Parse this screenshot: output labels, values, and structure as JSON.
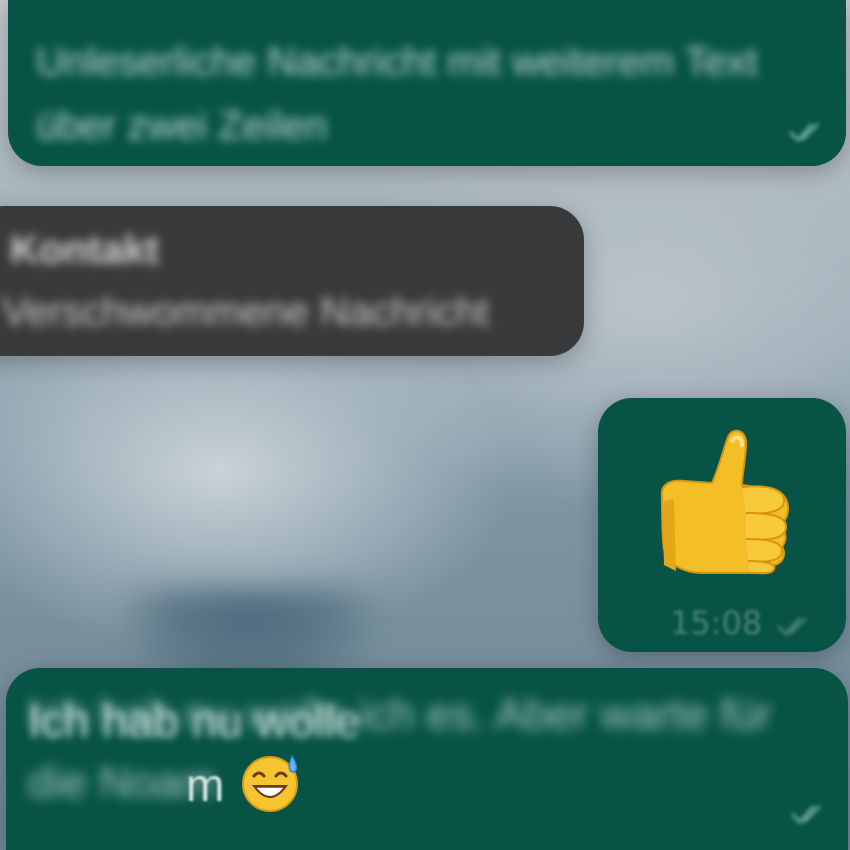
{
  "messages": [
    {
      "id": "msg-1",
      "direction": "outgoing",
      "text": "Unleserliche Nachricht mit weiterem Text über zwei Zeilen"
    },
    {
      "id": "msg-2",
      "direction": "incoming",
      "sender": "Kontakt",
      "text": "Verschwommene Nachricht"
    },
    {
      "id": "msg-3",
      "direction": "outgoing",
      "emoji": "thumbs-up",
      "time": "15:08"
    },
    {
      "id": "msg-4",
      "direction": "outgoing",
      "text_line1": "Ich hab nu wolle",
      "text_line2": "m",
      "emoji": "grinning-face-with-sweat"
    }
  ],
  "colors": {
    "outgoing_bubble": "#075346",
    "incoming_bubble": "#393a3c",
    "meta_text": "#5e9488"
  }
}
